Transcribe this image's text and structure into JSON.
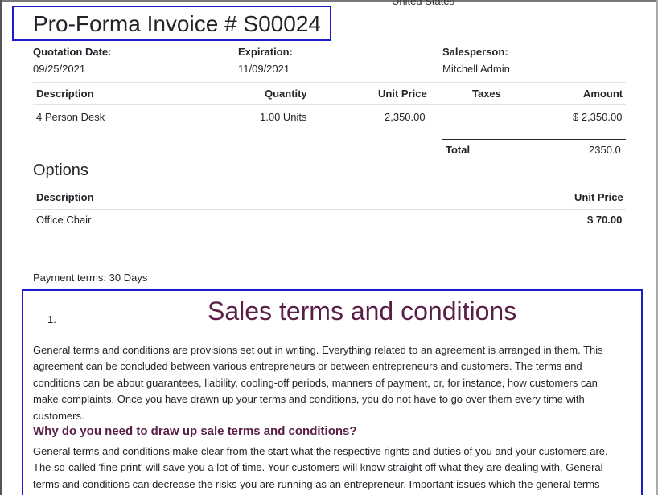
{
  "address": {
    "country": "United States"
  },
  "invoice": {
    "title": "Pro-Forma Invoice # S00024"
  },
  "info": {
    "quotation_date_label": "Quotation Date:",
    "quotation_date": "09/25/2021",
    "expiration_label": "Expiration:",
    "expiration": "11/09/2021",
    "salesperson_label": "Salesperson:",
    "salesperson": "Mitchell Admin"
  },
  "lines": {
    "headers": {
      "description": "Description",
      "quantity": "Quantity",
      "unit_price": "Unit Price",
      "taxes": "Taxes",
      "amount": "Amount"
    },
    "rows": [
      {
        "description": "4 Person Desk",
        "quantity": "1.00 Units",
        "unit_price": "2,350.00",
        "taxes": "",
        "amount": "$ 2,350.00"
      }
    ],
    "total_label": "Total",
    "total_value": "2350.0"
  },
  "options": {
    "title": "Options",
    "headers": {
      "description": "Description",
      "unit_price": "Unit Price"
    },
    "rows": [
      {
        "description": "Office Chair",
        "unit_price": "$ 70.00"
      }
    ]
  },
  "payment_terms": "Payment terms: 30 Days",
  "terms": {
    "list_number": "1.",
    "title": "Sales terms and conditions",
    "para1_lines": [
      "General terms and conditions are provisions set out in writing. Everything related to an agreement is arranged in them. This",
      "agreement can be concluded between various entrepreneurs or between entrepreneurs and customers. The terms and",
      "conditions can be about guarantees, liability, cooling-off periods, manners of payment, or, for instance, how customers can",
      "make complaints. Once you have drawn up your terms and conditions, you do not have to go over them every time with",
      "customers."
    ],
    "subheading": "Why do you need to draw up sale terms and conditions?",
    "para2_lines": [
      "General terms and conditions make clear from the start what the respective rights and duties of you and your customers are.",
      "The so-called 'fine print' will save you a lot of time. Your customers will know straight off what they are dealing with. General",
      "terms and conditions can decrease the risks you are running as an entrepreneur. Important issues which the general terms"
    ]
  }
}
